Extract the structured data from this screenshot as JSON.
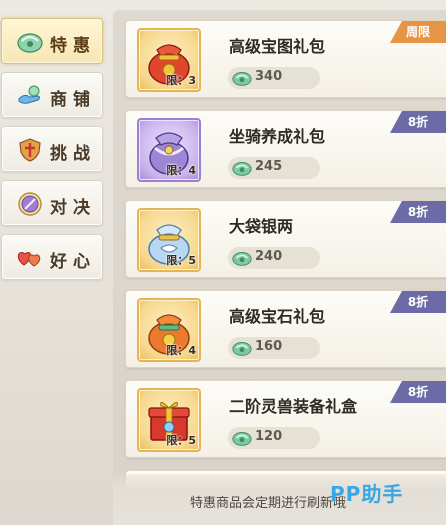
{
  "tabs": [
    {
      "label": "特惠",
      "icon": "jade-icon",
      "active": true
    },
    {
      "label": "商铺",
      "icon": "shop-hand-icon",
      "active": false
    },
    {
      "label": "挑战",
      "icon": "shield-sword-icon",
      "active": false
    },
    {
      "label": "对决",
      "icon": "crossed-swords-icon",
      "active": false
    },
    {
      "label": "好心",
      "icon": "hearts-icon",
      "active": false
    }
  ],
  "items": [
    {
      "name": "高级宝图礼包",
      "price": "340",
      "limit": "限：3",
      "badge": "周限",
      "badge_color": "#e59545",
      "bag": "red-bag-icon"
    },
    {
      "name": "坐骑养成礼包",
      "price": "245",
      "limit": "限：4",
      "badge": "8折",
      "badge_color": "#6c6ba7",
      "bag": "purple-bag-icon"
    },
    {
      "name": "大袋银两",
      "price": "240",
      "limit": "限：5",
      "badge": "8折",
      "badge_color": "#6c6ba7",
      "bag": "silver-bag-icon"
    },
    {
      "name": "高级宝石礼包",
      "price": "160",
      "limit": "限：4",
      "badge": "8折",
      "badge_color": "#6c6ba7",
      "bag": "orange-bag-icon"
    },
    {
      "name": "二阶灵兽装备礼盒",
      "price": "120",
      "limit": "限：5",
      "badge": "8折",
      "badge_color": "#6c6ba7",
      "bag": "red-giftbox-icon"
    }
  ],
  "currency_icon": "jade-currency-icon",
  "footer": {
    "notice": "特惠商品会定期进行刷新哦"
  },
  "watermark": "PP助手"
}
